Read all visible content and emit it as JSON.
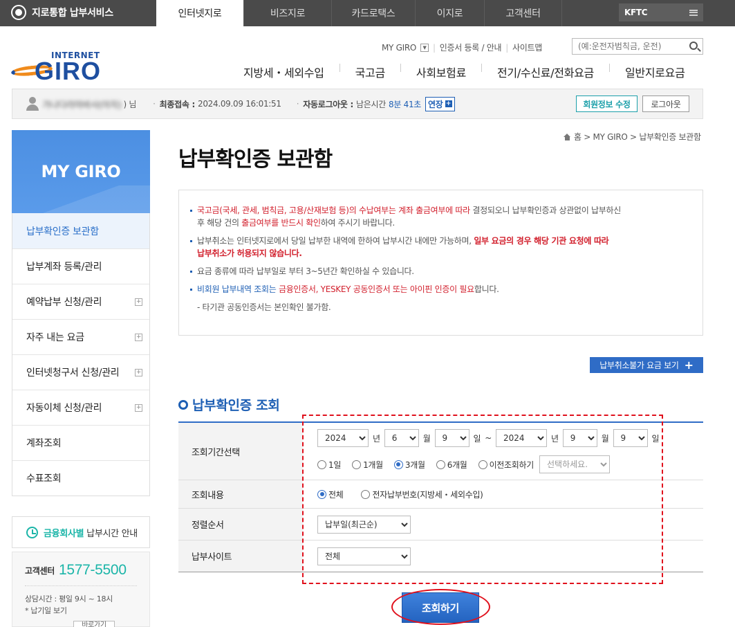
{
  "topbar": {
    "brand": "지로통합 납부서비스",
    "tabs": [
      "인터넷지로",
      "비즈지로",
      "카드로택스",
      "이지로",
      "고객센터"
    ],
    "kftc": "KFTC"
  },
  "header": {
    "logo_small": "INTERNET",
    "logo_big": "GIRO",
    "utils": [
      "MY GIRO",
      "인증서 등록 / 안내",
      "사이트맵"
    ],
    "search_placeholder": "(예:운전자범칙금, 운전)",
    "gnb": [
      "지방세・세외수입",
      "국고금",
      "사회보험료",
      "전기/수신료/전화요금",
      "일반지로요금"
    ]
  },
  "member": {
    "name_masked": "가나다라마바사(아자)",
    "suffix": ") 님",
    "last_label": "최종접속 :",
    "last_value": "2024.09.09 16:01:51",
    "auto_label": "자동로그아웃 :",
    "auto_prefix": "남은시간",
    "auto_time": "8분 41초",
    "extend": "연장",
    "edit": "회원정보 수정",
    "logout": "로그아웃"
  },
  "sidebar": {
    "title": "MY GIRO",
    "items": [
      {
        "label": "납부확인증 보관함",
        "plus": false
      },
      {
        "label": "납부계좌 등록/관리",
        "plus": false
      },
      {
        "label": "예약납부 신청/관리",
        "plus": true
      },
      {
        "label": "자주 내는 요금",
        "plus": true
      },
      {
        "label": "인터넷청구서 신청/관리",
        "plus": true
      },
      {
        "label": "자동이체 신청/관리",
        "plus": true
      },
      {
        "label": "계좌조회",
        "plus": false
      },
      {
        "label": "수표조회",
        "plus": false
      }
    ],
    "pay_time_hl": "금융회사별",
    "pay_time": "납부시간 안내",
    "cc_label": "고객센터",
    "cc_phone": "1577-5500",
    "cc_hours": "상담시간 : 평일 9시 ~ 18시",
    "cc_note": "* 납기일 보기",
    "cc_btn": "바로가기"
  },
  "breadcrumb": "홈 > MY GIRO > 납부확인증 보관함",
  "page_title": "납부확인증 보관함",
  "notice": {
    "n1_red": "국고금(국세, 관세, 범칙금, 고용/산재보험 등)의 수납여부는 계좌 출금여부에 따라",
    "n1_rest": " 결정되오니 납부확인증과 상관없이 납부하신",
    "n1_l2a": "후 해당 건의 ",
    "n1_l2red": "출금여부를 반드시 확인",
    "n1_l2b": "하여 주시기 바랍니다.",
    "n2_a": "납부취소는 인터넷지로에서 당일 납부한 내역에 한하여 납부시간 내에만 가능하며, ",
    "n2_red": "일부 요금의 경우 해당 기관 요청에 따라",
    "n2_red2": "납부취소가 허용되지 않습니다.",
    "n3": "요금 종류에 따라 납부일로 부터 3~5년간 확인하실 수 있습니다.",
    "n4_a": "비회원 납부내역 조회는",
    "n4_red": " 금융인증서, YESKEY 공동인증서 또는 아이핀 인증이 필요",
    "n4_b": "합니다.",
    "n5": "- 타기관 공동인증서는 본인확인 불가함."
  },
  "cancel_list_btn": "납부취소불가 요금 보기",
  "section_title": "납부확인증 조회",
  "form": {
    "period_label": "조회기간선택",
    "from_year": "2024",
    "from_month": "6",
    "from_day": "9",
    "to_year": "2024",
    "to_month": "9",
    "to_day": "9",
    "unit_year": "년",
    "unit_month": "월",
    "unit_day": "일",
    "tilde": "~",
    "period_opts": [
      "1일",
      "1개월",
      "3개월",
      "6개월",
      "이전조회하기"
    ],
    "period_selected": "3개월",
    "prev_select": "선택하세요.",
    "content_label": "조회내용",
    "content_opts": [
      "전체",
      "전자납부번호(지방세・세외수입)"
    ],
    "content_selected": "전체",
    "sort_label": "정렬순서",
    "sort_value": "납부일(최근순)",
    "site_label": "납부사이트",
    "site_value": "전체"
  },
  "search_btn": "조회하기",
  "colors": {
    "accent": "#2f6cc6",
    "teal": "#1bb5a8",
    "red": "#d2202d",
    "topbar": "#4a4a4a",
    "annotation": "#e0101c"
  }
}
